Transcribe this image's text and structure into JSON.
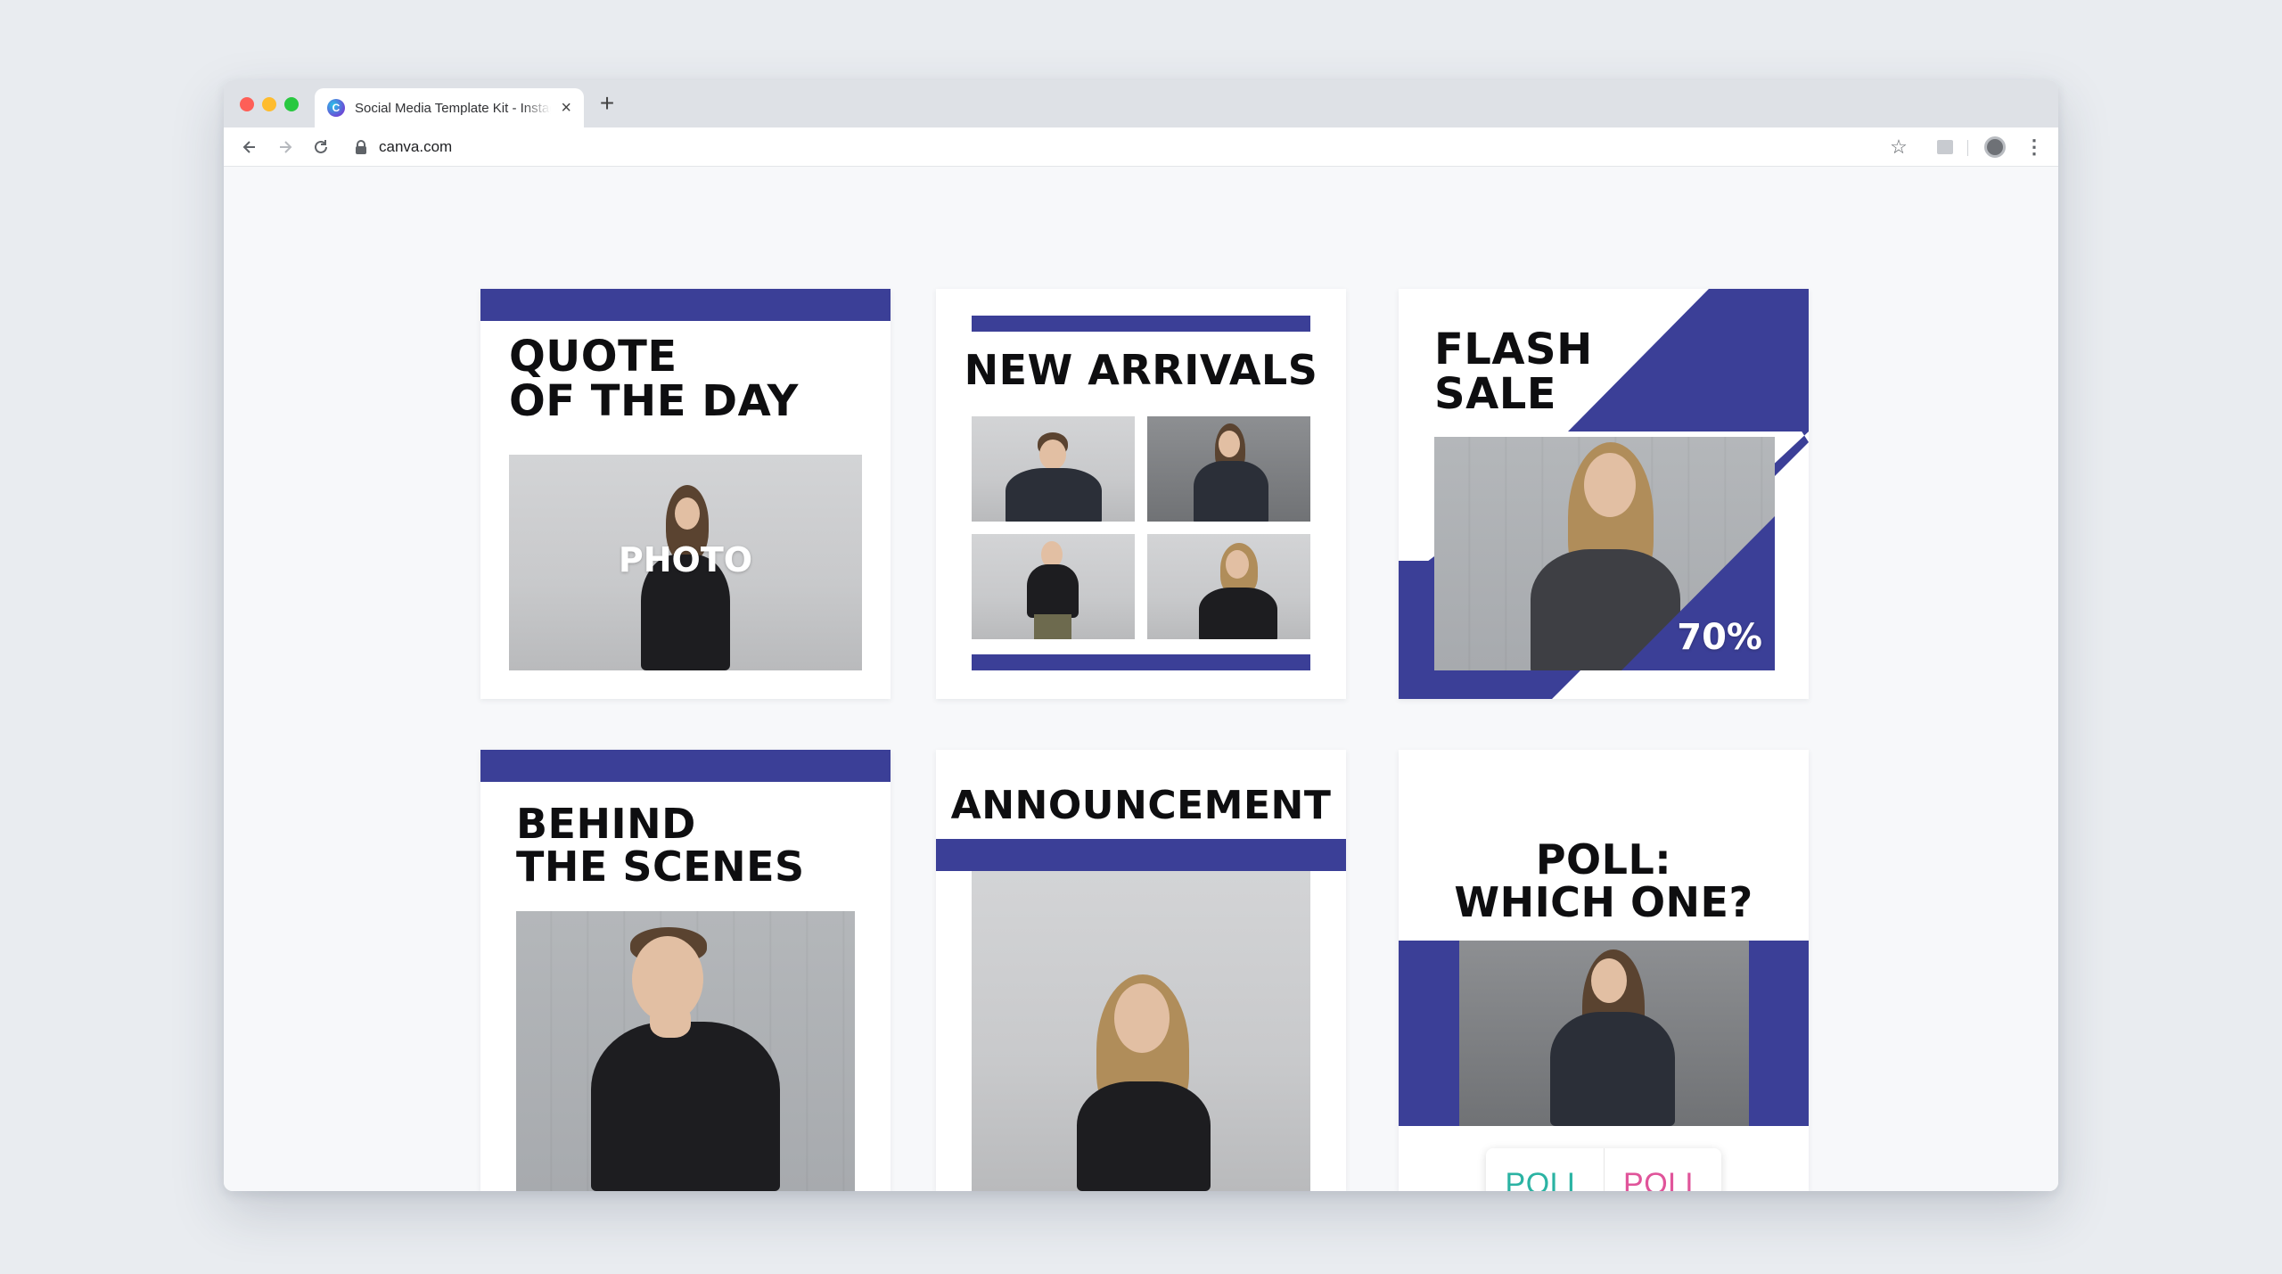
{
  "browser": {
    "tab_title": "Social Media Template Kit - Instagram",
    "url": "canva.com",
    "new_tab_symbol": "+",
    "tab_close_symbol": "×"
  },
  "cards": {
    "quote": {
      "heading": "QUOTE\nOF THE DAY",
      "photo_label": "PHOTO"
    },
    "arrivals": {
      "heading": "NEW ARRIVALS"
    },
    "flash": {
      "heading": "FLASH\nSALE",
      "discount": "70%"
    },
    "behind": {
      "heading": "BEHIND\nTHE SCENES"
    },
    "announcement": {
      "heading": "ANNOUNCEMENT"
    },
    "poll": {
      "heading": "POLL:\nWHICH ONE?",
      "option_a": "POLL",
      "option_b": "POLL"
    }
  },
  "colors": {
    "brand_navy": "#3b3f97",
    "poll_option_a": "#2bb3a3",
    "poll_option_b": "#e0549a"
  },
  "icons": [
    "back-arrow-icon",
    "forward-arrow-icon",
    "reload-icon",
    "lock-icon",
    "star-icon",
    "extension-icon",
    "profile-icon",
    "menu-dots-icon"
  ]
}
